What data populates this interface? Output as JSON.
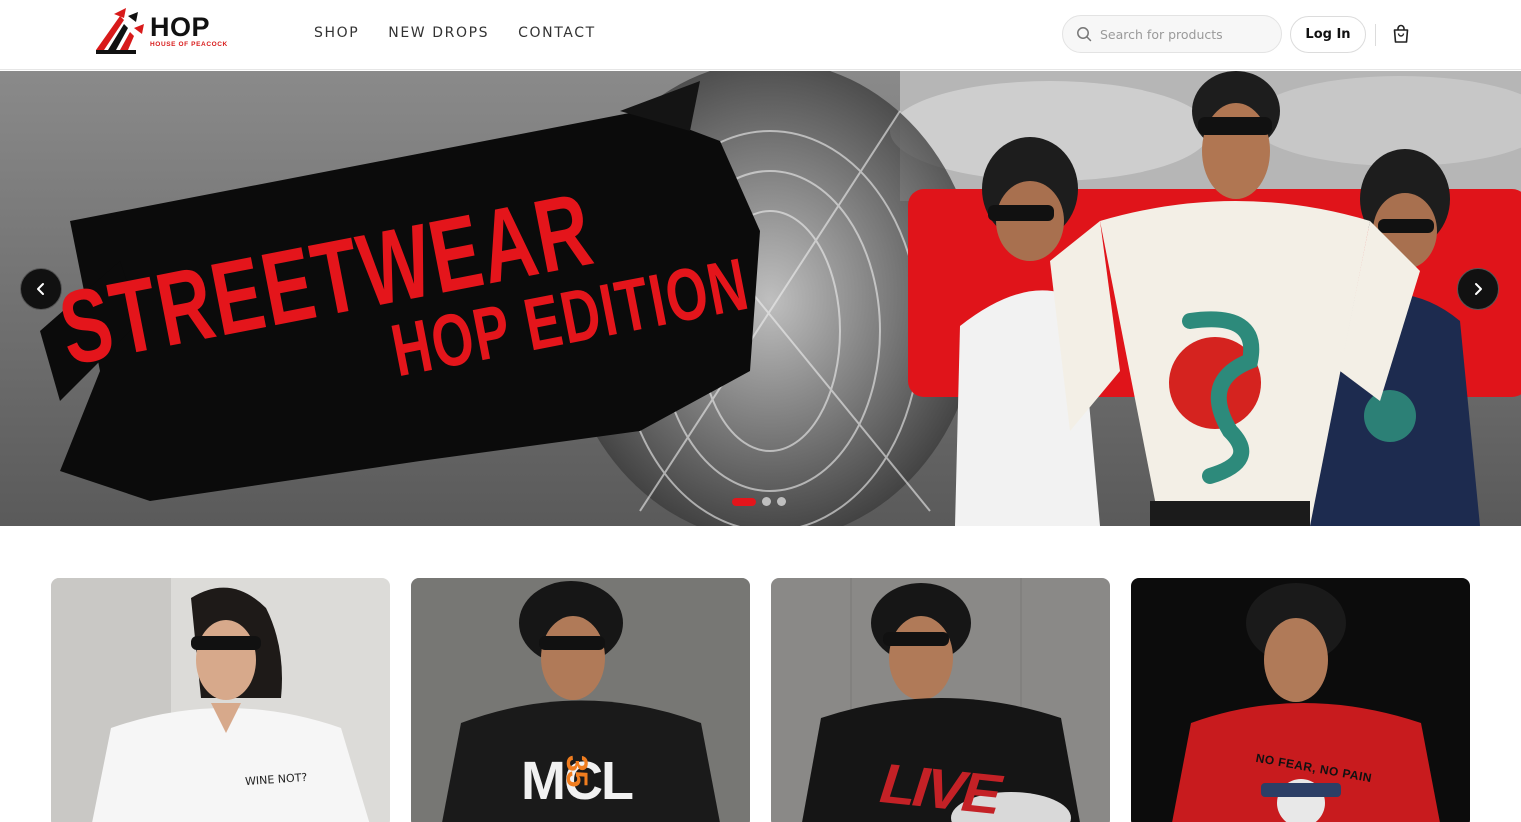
{
  "brand": {
    "name": "HOP",
    "tagline": "HOUSE OF PEACOCK",
    "accent_color": "#e4151b"
  },
  "nav": {
    "items": [
      {
        "label": "SHOP"
      },
      {
        "label": "NEW DROPS"
      },
      {
        "label": "CONTACT"
      }
    ]
  },
  "search": {
    "placeholder": "Search for products",
    "value": "",
    "icon": "search-icon"
  },
  "auth": {
    "login_label": "Log In"
  },
  "cart": {
    "icon": "shopping-bag-icon"
  },
  "hero": {
    "line1": "STREETWEAR",
    "line2": "HOP EDITION",
    "prev_icon": "chevron-left-icon",
    "next_icon": "chevron-right-icon",
    "slides_total": 3,
    "active_slide": 1
  },
  "products": [
    {
      "print_text": "WINE NOT?",
      "shirt_color": "#f4f4f4"
    },
    {
      "print_text": "MCL",
      "print_number": "35",
      "shirt_color": "#1a1a1a"
    },
    {
      "print_text": "LIVE",
      "shirt_color": "#151515"
    },
    {
      "print_text": "NO FEAR, NO PAIN",
      "shirt_color": "#c81b1e"
    }
  ]
}
